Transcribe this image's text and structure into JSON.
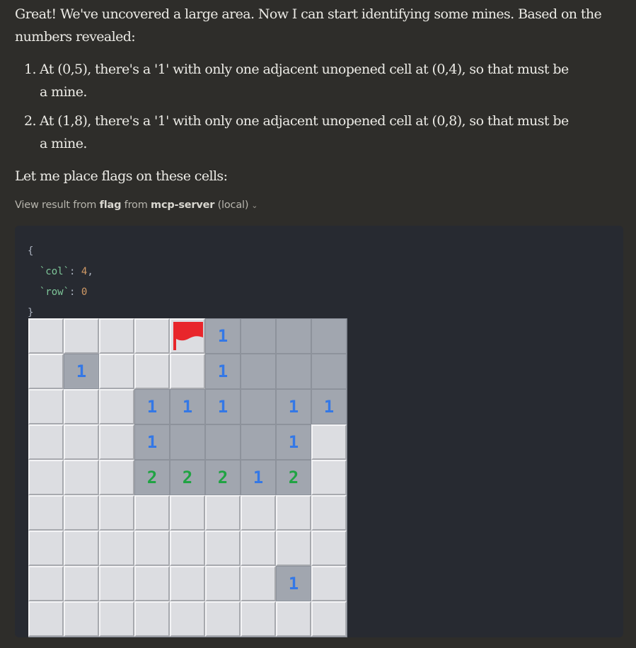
{
  "message": {
    "intro": "Great! We've uncovered a large area. Now I can start identifying some mines. Based on the numbers revealed:",
    "steps": [
      {
        "num": "1.",
        "text": "At (0,5), there's a '1' with only one adjacent unopened cell at (0,4), so that must be a mine."
      },
      {
        "num": "2.",
        "text": "At (1,8), there's a '1' with only one adjacent unopened cell at (0,8), so that must be a mine."
      }
    ],
    "outro": "Let me place flags on these cells:"
  },
  "tool": {
    "prefix": "View result from ",
    "name": "flag",
    "middle": " from ",
    "server": "mcp-server",
    "suffix": " (local)",
    "chevron_icon": "chevron-down-icon"
  },
  "code": {
    "open_brace": "{",
    "col_key": "`col`",
    "col_value": "4",
    "row_key": "`row`",
    "row_value": "0",
    "close_brace": "}"
  },
  "board": {
    "rows": 9,
    "cols": 9,
    "flag_icon": "flag-icon",
    "colors": {
      "one": "#3478e6",
      "two": "#20a343",
      "flag": "#e8262b"
    },
    "grid": [
      [
        "C",
        "C",
        "C",
        "C",
        "F",
        "1",
        "O",
        "O",
        "O"
      ],
      [
        "C",
        "1",
        "C",
        "C",
        "C",
        "1",
        "O",
        "O",
        "O"
      ],
      [
        "C",
        "C",
        "C",
        "1",
        "1",
        "1",
        "O",
        "1",
        "1"
      ],
      [
        "C",
        "C",
        "C",
        "1",
        "O",
        "O",
        "O",
        "1",
        "C"
      ],
      [
        "C",
        "C",
        "C",
        "2",
        "2",
        "2",
        "1",
        "2",
        "C"
      ],
      [
        "C",
        "C",
        "C",
        "C",
        "C",
        "C",
        "C",
        "C",
        "C"
      ],
      [
        "C",
        "C",
        "C",
        "C",
        "C",
        "C",
        "C",
        "C",
        "C"
      ],
      [
        "C",
        "C",
        "C",
        "C",
        "C",
        "C",
        "C",
        "1",
        "C"
      ],
      [
        "C",
        "C",
        "C",
        "C",
        "C",
        "C",
        "C",
        "C",
        "C"
      ]
    ]
  }
}
